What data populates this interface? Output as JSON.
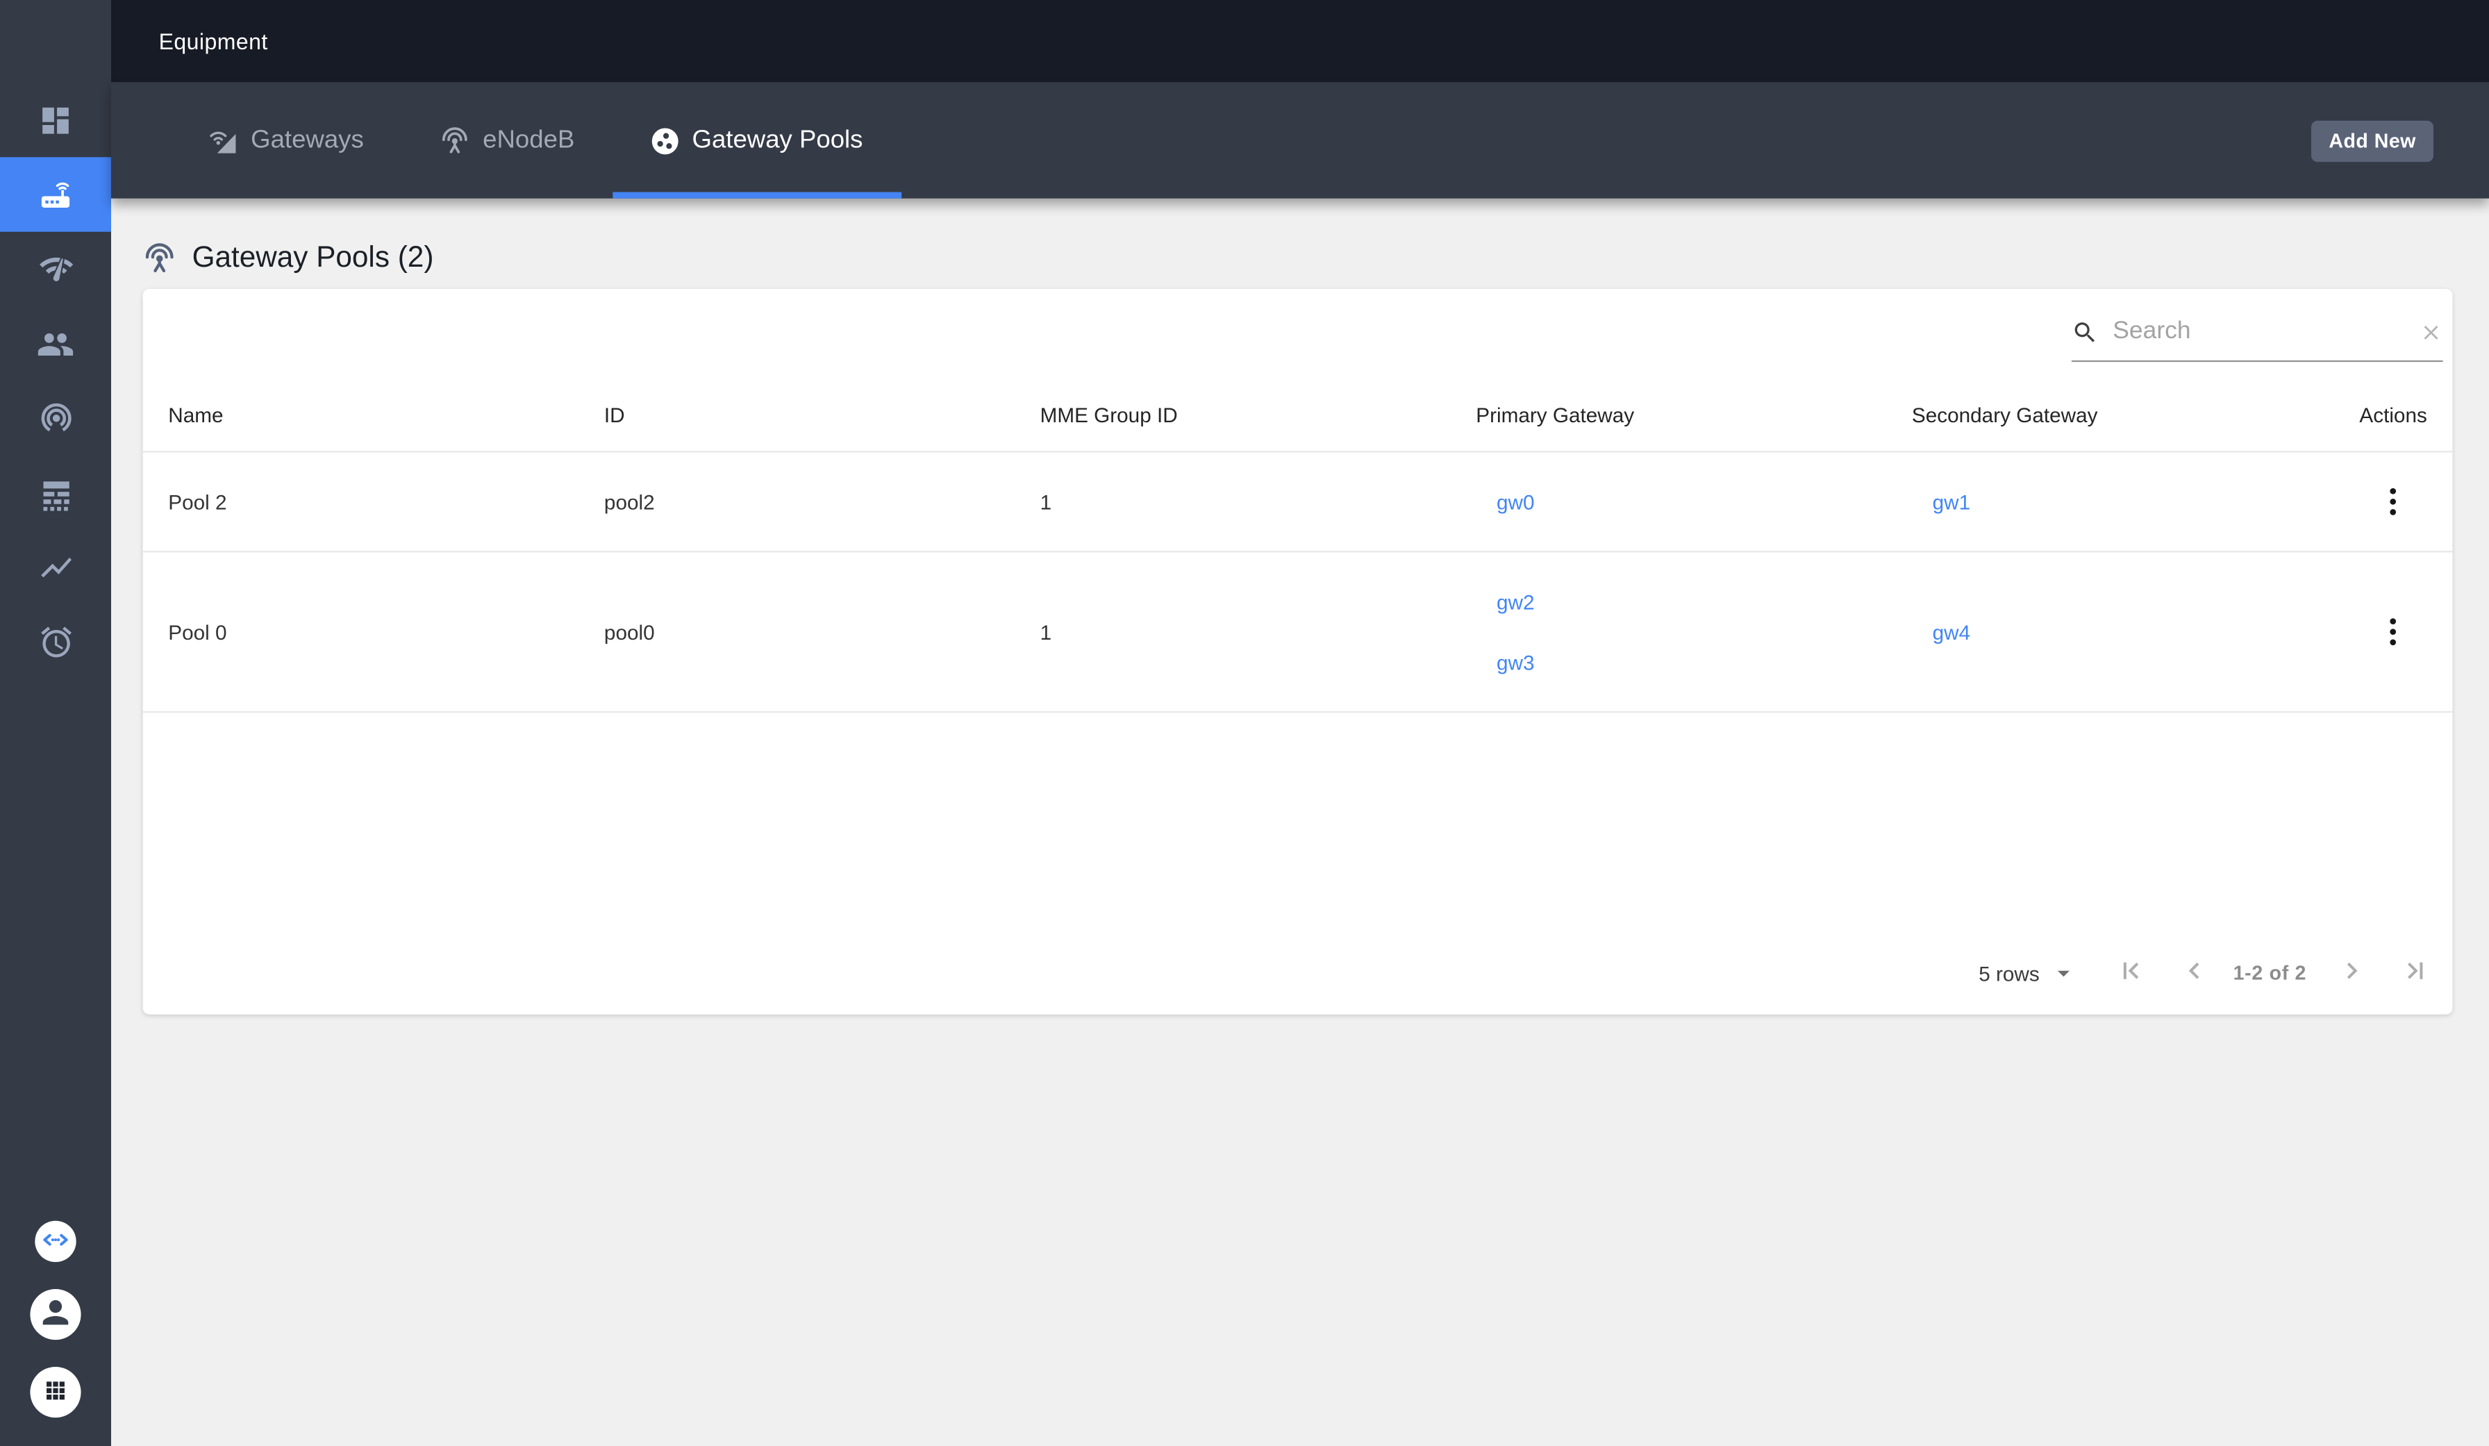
{
  "colors": {
    "primary_blue": "#4484F4",
    "link_blue": "#4285F4",
    "topbar_bg": "#171B25",
    "tabbar_bg": "#343A46",
    "sidebar_bg": "#343A46",
    "page_bg": "#F0F0F0",
    "card_bg": "#FFFFFF",
    "add_new_bg": "#5B6377",
    "inactive_tab_text": "#A3A9B5",
    "sidebar_icon_color": "#9AA6BB"
  },
  "topbar": {
    "title": "Equipment"
  },
  "tabbar": {
    "tabs": [
      {
        "label": "Gateways",
        "icon": "gateways-tab-icon",
        "active": false
      },
      {
        "label": "eNodeB",
        "icon": "enodeb-tab-icon",
        "active": false
      },
      {
        "label": "Gateway Pools",
        "icon": "gateway-pools-tab-icon",
        "active": true
      }
    ],
    "add_new_label": "Add New"
  },
  "sidebar": {
    "items": [
      {
        "icon": "dashboard-icon",
        "active": false
      },
      {
        "icon": "equipment-router-icon",
        "active": true
      },
      {
        "icon": "network-check-icon",
        "active": false
      },
      {
        "icon": "subscribers-people-icon",
        "active": false
      },
      {
        "icon": "tracing-radar-icon",
        "active": false
      },
      {
        "icon": "metrics-bars-icon",
        "active": false
      },
      {
        "icon": "call-flow-chart-icon",
        "active": false
      },
      {
        "icon": "alarms-clock-icon",
        "active": false
      }
    ],
    "bottom_items": [
      {
        "icon": "api-code-icon"
      },
      {
        "icon": "account-person-icon"
      },
      {
        "icon": "apps-grid-icon"
      }
    ]
  },
  "page": {
    "title": "Gateway Pools (2)",
    "search": {
      "placeholder": "Search",
      "value": ""
    },
    "table": {
      "headers": [
        "Name",
        "ID",
        "MME Group ID",
        "Primary Gateway",
        "Secondary Gateway",
        "Actions"
      ],
      "rows": [
        {
          "name": "Pool 2",
          "id": "pool2",
          "mme_group_id": "1",
          "primary_gateways": [
            "gw0"
          ],
          "secondary_gateways": [
            "gw1"
          ]
        },
        {
          "name": "Pool 0",
          "id": "pool0",
          "mme_group_id": "1",
          "primary_gateways": [
            "gw2",
            "gw3"
          ],
          "secondary_gateways": [
            "gw4"
          ]
        }
      ]
    },
    "pagination": {
      "rows_per_page_label": "5 rows",
      "range_label": "1-2 of 2"
    }
  }
}
